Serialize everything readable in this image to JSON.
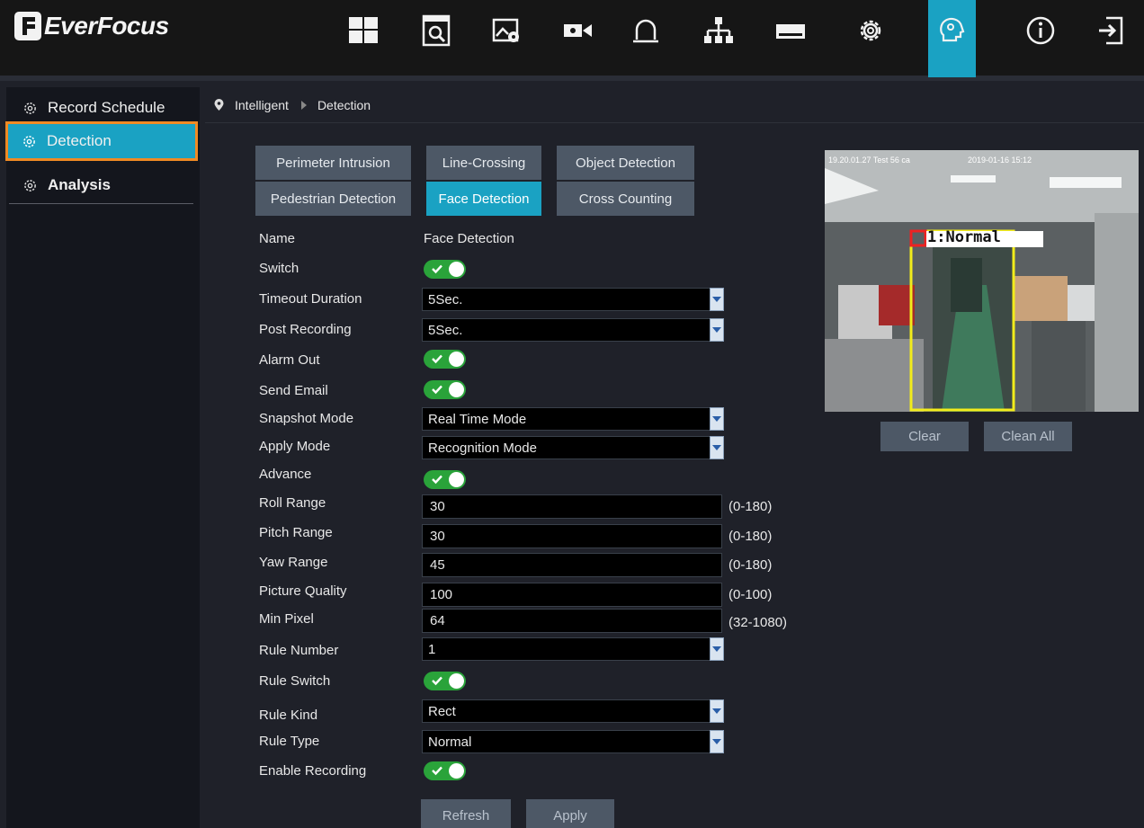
{
  "app": {
    "brand": "EverFocus"
  },
  "topnav": {
    "items": [
      {
        "icon": "layout-grid-icon"
      },
      {
        "icon": "playback-search-icon"
      },
      {
        "icon": "image-settings-icon"
      },
      {
        "icon": "camera-icon"
      },
      {
        "icon": "alarm-bell-icon"
      },
      {
        "icon": "network-icon"
      },
      {
        "icon": "storage-hdd-icon"
      },
      {
        "icon": "system-gear-icon"
      },
      {
        "icon": "intelligent-head-icon",
        "active": true
      },
      {
        "icon": "info-icon"
      },
      {
        "icon": "logout-icon"
      }
    ],
    "active_color": "#1aa2c3"
  },
  "sidebar": {
    "items": [
      {
        "label": "Record Schedule"
      },
      {
        "label": "Detection",
        "active": true
      },
      {
        "label": "Analysis"
      }
    ]
  },
  "breadcrumb": {
    "section": "Intelligent",
    "page": "Detection"
  },
  "tabs": [
    {
      "label": "Perimeter Intrusion"
    },
    {
      "label": "Line-Crossing"
    },
    {
      "label": "Object Detection"
    },
    {
      "label": "Pedestrian Detection"
    },
    {
      "label": "Face Detection",
      "active": true
    },
    {
      "label": "Cross Counting"
    }
  ],
  "form": {
    "name_label": "Name",
    "name_value": "Face Detection",
    "switch_label": "Switch",
    "switch_on": true,
    "timeout_label": "Timeout Duration",
    "timeout_value": "5Sec.",
    "post_recording_label": "Post Recording",
    "post_recording_value": "5Sec.",
    "alarm_out_label": "Alarm Out",
    "alarm_out_on": true,
    "send_email_label": "Send Email",
    "send_email_on": true,
    "snapshot_mode_label": "Snapshot Mode",
    "snapshot_mode_value": "Real Time Mode",
    "apply_mode_label": "Apply Mode",
    "apply_mode_value": "Recognition Mode",
    "advance_label": "Advance",
    "advance_on": true,
    "roll_label": "Roll Range",
    "roll_value": "30",
    "roll_range": "(0-180)",
    "pitch_label": "Pitch Range",
    "pitch_value": "30",
    "pitch_range": "(0-180)",
    "yaw_label": "Yaw Range",
    "yaw_value": "45",
    "yaw_range": "(0-180)",
    "quality_label": "Picture Quality",
    "quality_value": "100",
    "quality_range": "(0-100)",
    "min_pixel_label": "Min Pixel",
    "min_pixel_value": "64",
    "min_pixel_range": "(32-1080)",
    "rule_number_label": "Rule Number",
    "rule_number_value": "1",
    "rule_switch_label": "Rule Switch",
    "rule_switch_on": true,
    "rule_kind_label": "Rule Kind",
    "rule_kind_value": "Rect",
    "rule_type_label": "Rule Type",
    "rule_type_value": "Normal",
    "enable_recording_label": "Enable Recording",
    "enable_recording_on": true
  },
  "buttons": {
    "refresh": "Refresh",
    "apply": "Apply",
    "clear": "Clear",
    "clean_all": "Clean All"
  },
  "preview": {
    "rule_label": "1:Normal"
  },
  "colors": {
    "accent": "#1aa2c3",
    "toggle_on": "#2aa33a",
    "highlight_outline": "#f08a24",
    "rule_box": "#f2ec1b"
  }
}
